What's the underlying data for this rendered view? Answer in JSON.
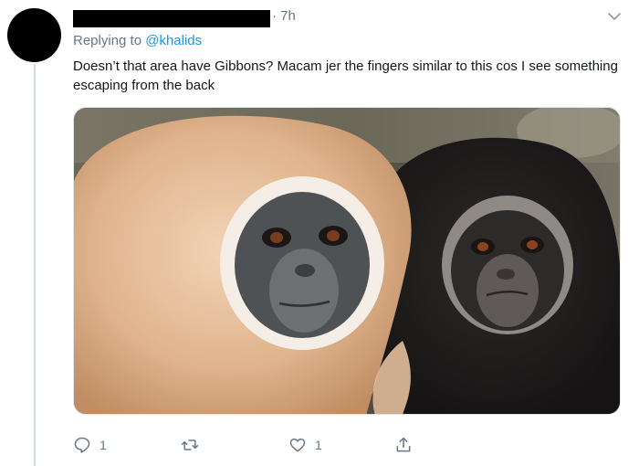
{
  "tweet": {
    "time": "· 7h",
    "replying_prefix": "Replying to ",
    "replying_handle": "@khalids",
    "text": "Doesn’t that area have Gibbons? Macam jer the fingers similar to this cos I see something escaping from the back"
  },
  "actions": {
    "reply_count": "1",
    "retweet_count": "",
    "like_count": "1"
  },
  "icons": {
    "reply": "reply-icon",
    "retweet": "retweet-icon",
    "like": "like-icon",
    "share": "share-icon",
    "more": "chevron-down-icon"
  },
  "colors": {
    "link": "#1b95e0",
    "secondary_text": "#657786",
    "text": "#14171a"
  }
}
